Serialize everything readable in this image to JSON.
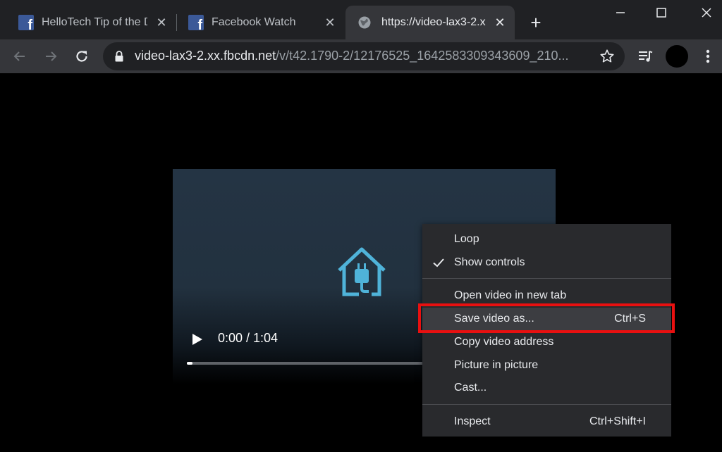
{
  "tabs": [
    {
      "title": "HelloTech Tip of the D",
      "favicon": "facebook-icon",
      "close": "✕"
    },
    {
      "title": "Facebook Watch",
      "favicon": "facebook-icon",
      "close": "✕"
    },
    {
      "title": "https://video-lax3-2.x",
      "favicon": "globe-icon",
      "close": "✕",
      "active": true
    }
  ],
  "new_tab": "+",
  "address": {
    "host": "video-lax3-2.xx.fbcdn.net",
    "path": "/v/t42.1790-2/12176525_1642583309343609_210..."
  },
  "video": {
    "time": "0:00 / 1:04",
    "progress": 0.015
  },
  "context_menu": {
    "items": [
      {
        "label": "Loop",
        "shortcut": "",
        "checked": false
      },
      {
        "label": "Show controls",
        "shortcut": "",
        "checked": true
      },
      {
        "label": "Open video in new tab",
        "shortcut": ""
      },
      {
        "label": "Save video as...",
        "shortcut": "Ctrl+S",
        "highlighted": true
      },
      {
        "label": "Copy video address",
        "shortcut": ""
      },
      {
        "label": "Picture in picture",
        "shortcut": ""
      },
      {
        "label": "Cast...",
        "shortcut": ""
      },
      {
        "label": "Inspect",
        "shortcut": "Ctrl+Shift+I"
      }
    ]
  },
  "colors": {
    "highlight_border": "#e81010",
    "facebook_blue": "#3b5998",
    "house_icon": "#4fb3d9"
  }
}
